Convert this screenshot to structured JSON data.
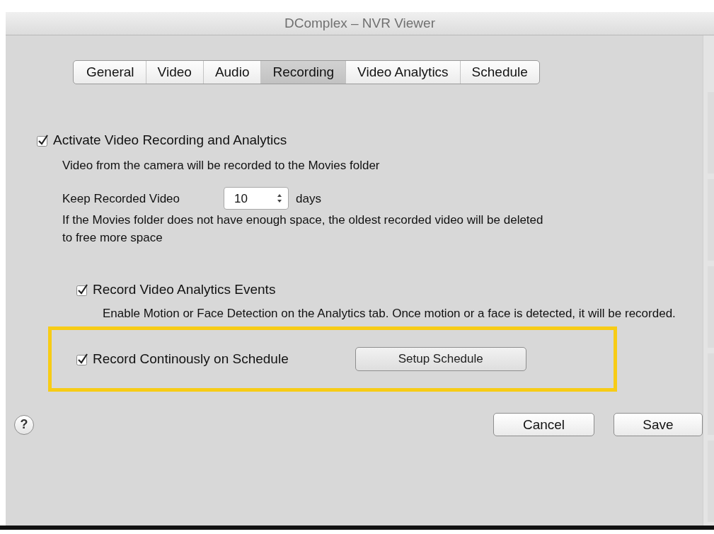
{
  "window": {
    "title": "DComplex – NVR Viewer"
  },
  "tabs": [
    {
      "label": "General",
      "selected": false
    },
    {
      "label": "Video",
      "selected": false
    },
    {
      "label": "Audio",
      "selected": false
    },
    {
      "label": "Recording",
      "selected": true
    },
    {
      "label": "Video Analytics",
      "selected": false
    },
    {
      "label": "Schedule",
      "selected": false
    }
  ],
  "activate": {
    "label": "Activate Video Recording and Analytics",
    "checked": true,
    "description": "Video from the camera will be recorded to the Movies folder"
  },
  "keep": {
    "label": "Keep Recorded Video",
    "value": "10",
    "unit": "days",
    "note": "If the Movies folder does not have enough space, the oldest recorded video will be deleted to free more space"
  },
  "analytics_events": {
    "label": "Record Video Analytics Events",
    "checked": true,
    "description": "Enable Motion or Face Detection on the Analytics tab. Once motion or a face is detected, it will be recorded."
  },
  "continuous": {
    "label": "Record Continously on Schedule",
    "checked": true,
    "button": "Setup Schedule",
    "highlighted": true
  },
  "help": {
    "label": "?"
  },
  "buttons": [
    "Cancel",
    "Save"
  ]
}
